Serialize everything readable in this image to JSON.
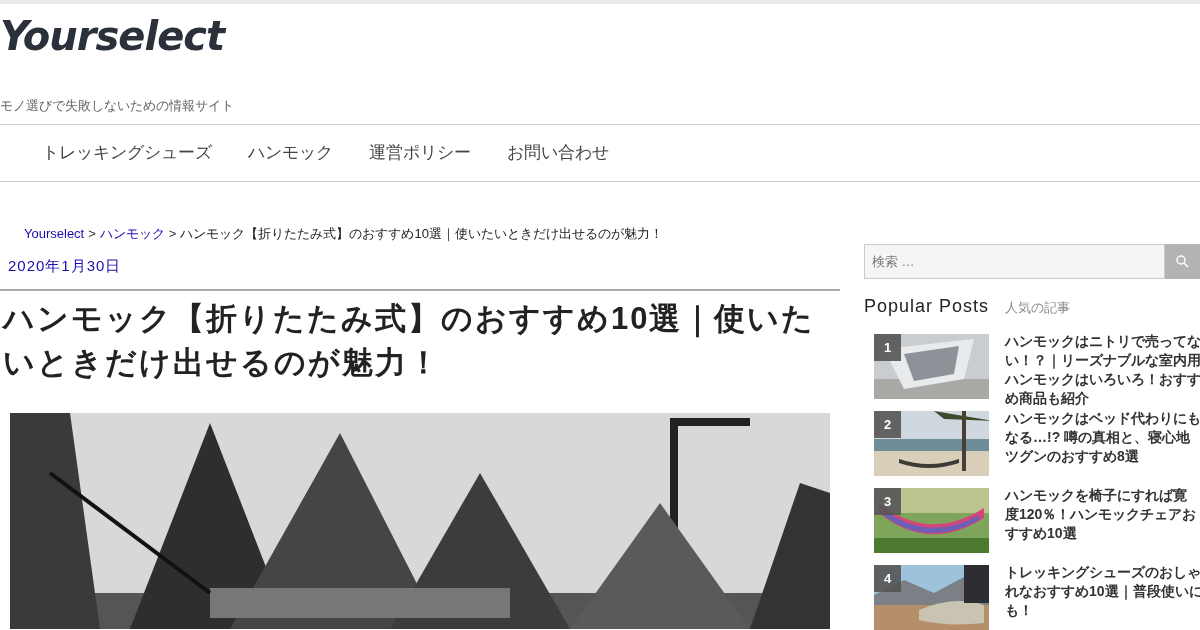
{
  "site": {
    "logo": "Yourselect",
    "tagline": "モノ選びで失敗しないための情報サイト"
  },
  "nav": [
    "トレッキングシューズ",
    "ハンモック",
    "運営ポリシー",
    "お問い合わせ"
  ],
  "breadcrumb": [
    {
      "label": "Yourselect",
      "kind": "link"
    },
    {
      "label": ">",
      "kind": "sep"
    },
    {
      "label": "ハンモック",
      "kind": "link"
    },
    {
      "label": ">",
      "kind": "sep"
    },
    {
      "label": "ハンモック【折りたたみ式】のおすすめ10選｜使いたいときだけ出せるのが魅力！",
      "kind": "text"
    }
  ],
  "article": {
    "date": "2020年1月30日",
    "title": "ハンモック【折りたたみ式】のおすすめ10選｜使いたいときだけ出せるのが魅力！"
  },
  "sidebar": {
    "search": {
      "placeholder": "検索 …"
    },
    "popular": {
      "title": "Popular Posts",
      "subtitle": "人気の記事",
      "posts": [
        {
          "rank": "1",
          "lines": [
            "ハンモックはニトリで売ってな",
            "い！？｜リーズナブルな室内用",
            "ハンモックはいろいろ！おすす",
            "め商品も紹介"
          ]
        },
        {
          "rank": "2",
          "kind": "beach",
          "lines": [
            "ハンモックはベッド代わりにも",
            "なる…!? 噂の真相と、寝心地",
            "ツグンのおすすめ8選"
          ]
        },
        {
          "rank": "3",
          "kind": "garden",
          "lines": [
            "ハンモックを椅子にすれば寛",
            "度120％！ハンモックチェアお",
            "すすめ10選"
          ]
        },
        {
          "rank": "4",
          "kind": "mountain",
          "lines": [
            "トレッキングシューズのおしゃ",
            "れなおすすめ10選｜普段使いに",
            "も！"
          ]
        }
      ]
    }
  }
}
